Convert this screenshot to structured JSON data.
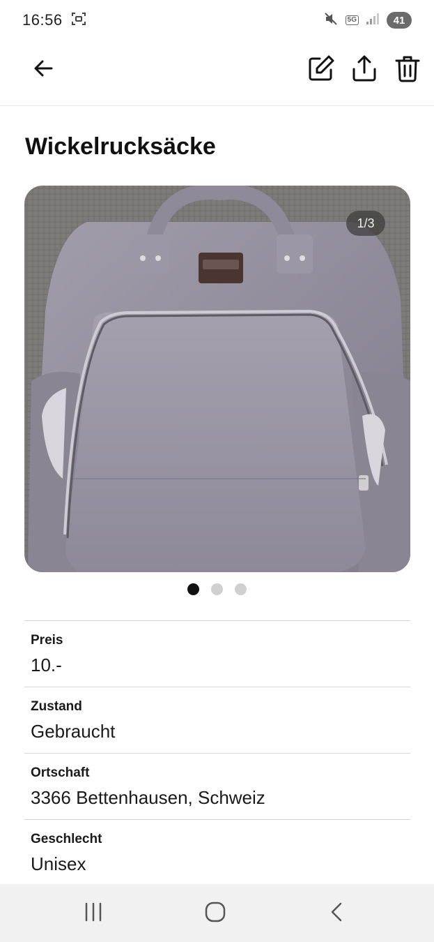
{
  "status_bar": {
    "time": "16:56",
    "network": "5G",
    "battery": "41"
  },
  "app_bar": {
    "icons": [
      "back-arrow-icon",
      "edit-icon",
      "share-icon",
      "trash-icon"
    ]
  },
  "listing": {
    "title": "Wickelrucksäcke",
    "gallery": {
      "counter": "1/3",
      "total_images": 3,
      "active_index": 1,
      "image_description": "grey backpack"
    },
    "details": [
      {
        "label": "Preis",
        "value": "10.-"
      },
      {
        "label": "Zustand",
        "value": "Gebraucht"
      },
      {
        "label": "Ortschaft",
        "value": "3366 Bettenhausen, Schweiz"
      },
      {
        "label": "Geschlecht",
        "value": "Unisex"
      }
    ]
  },
  "colors": {
    "text": "#111111",
    "divider": "#d6d6d6",
    "dot_active": "#111111",
    "dot_inactive": "#d0d0d0",
    "nav_bar": "#f1f1f1"
  }
}
